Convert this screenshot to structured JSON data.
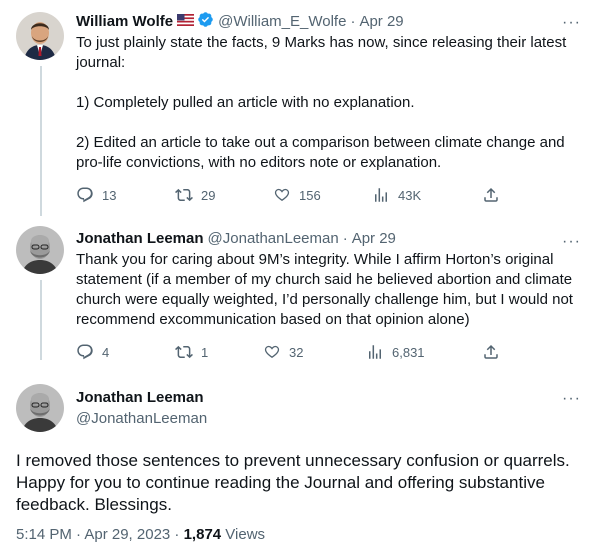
{
  "tweets": [
    {
      "name": "William Wolfe",
      "handle": "@William_E_Wolfe",
      "separator": "·",
      "date": "Apr 29",
      "text": "To just plainly state the facts, 9 Marks has now, since releasing their latest journal:\n\n1) Completely pulled an article with no explanation.\n\n2) Edited an article to take out a comparison between climate change and pro-life convictions, with no editors note or explanation.",
      "replies": "13",
      "retweets": "29",
      "likes": "156",
      "views": "43K"
    },
    {
      "name": "Jonathan Leeman",
      "handle": "@JonathanLeeman",
      "separator": "·",
      "date": "Apr 29",
      "text": "Thank you for caring about 9M’s integrity. While I affirm Horton’s original statement (if a member of my church said he believed abortion and climate church were equally weighted, I’d personally challenge him, but I would not recommend excommunication based on that opinion alone)",
      "replies": "4",
      "retweets": "1",
      "likes": "32",
      "views": "6,831"
    }
  ],
  "main": {
    "name": "Jonathan Leeman",
    "handle": "@JonathanLeeman",
    "text": "I removed those sentences to prevent unnecessary confusion or quarrels. Happy for you to continue reading the Journal and offering substantive feedback. Blessings.",
    "time": "5:14 PM · Apr 29, 2023 · ",
    "views_count": "1,874",
    "views_label": " Views"
  },
  "more_label": "···",
  "icons": [
    "reply-icon",
    "retweet-icon",
    "like-icon",
    "views-icon",
    "share-icon",
    "verified-icon",
    "us-flag-icon",
    "more-icon"
  ],
  "colors": {
    "text": "#0f1419",
    "secondary": "#536471",
    "verified": "#1d9bf0",
    "line": "#cfd9de"
  }
}
